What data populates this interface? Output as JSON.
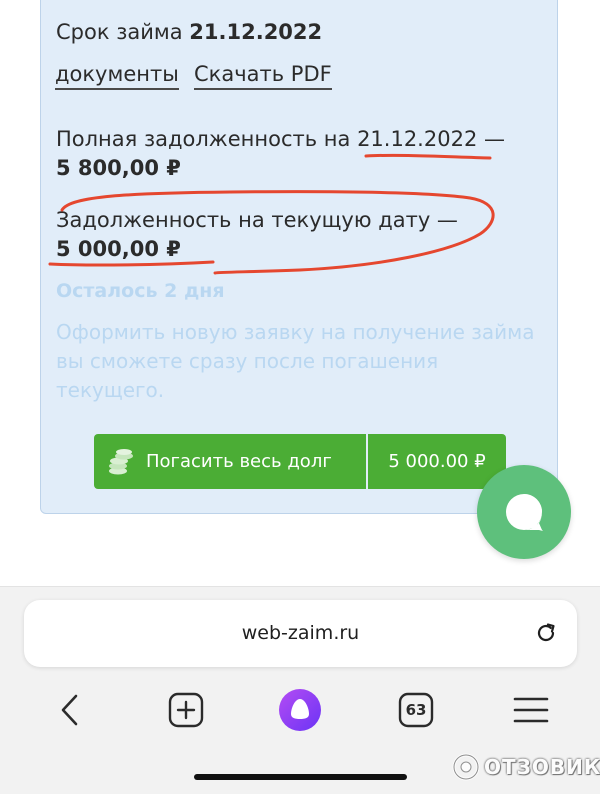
{
  "loan": {
    "term_label": "Срок займа",
    "term_date": "21.12.2022",
    "documents_link": "документы",
    "download_link": "Скачать PDF",
    "full_debt_label": "Полная задолженность на",
    "full_debt_date": "21.12.2022",
    "dash": "—",
    "full_debt_amount": "5 800,00 ₽",
    "current_debt_label": "Задолженность на текущую дату —",
    "current_debt_amount": "5 000,00 ₽",
    "remaining": "Осталось 2 дня",
    "notice": "Оформить новую заявку на получение займа вы сможете сразу после погашения текущего."
  },
  "actions": {
    "pay_label": "Погасить весь долг",
    "pay_amount": "5 000.00 ₽"
  },
  "browser": {
    "url": "web-zaim.ru",
    "tabs_count": "63"
  },
  "watermark": {
    "text": "ОТЗОВИК"
  },
  "colors": {
    "card_bg": "#e1edf9",
    "accent_green": "#4bad35",
    "chat_green": "#5ec07c",
    "annotation_red": "#e5472f",
    "alice_purple": "#8b3cf7"
  },
  "icons": [
    "coins-icon",
    "chat-icon",
    "reload-icon",
    "back-icon",
    "new-tab-icon",
    "alice-icon",
    "tabs-icon",
    "menu-icon",
    "watermark-logo-icon"
  ]
}
